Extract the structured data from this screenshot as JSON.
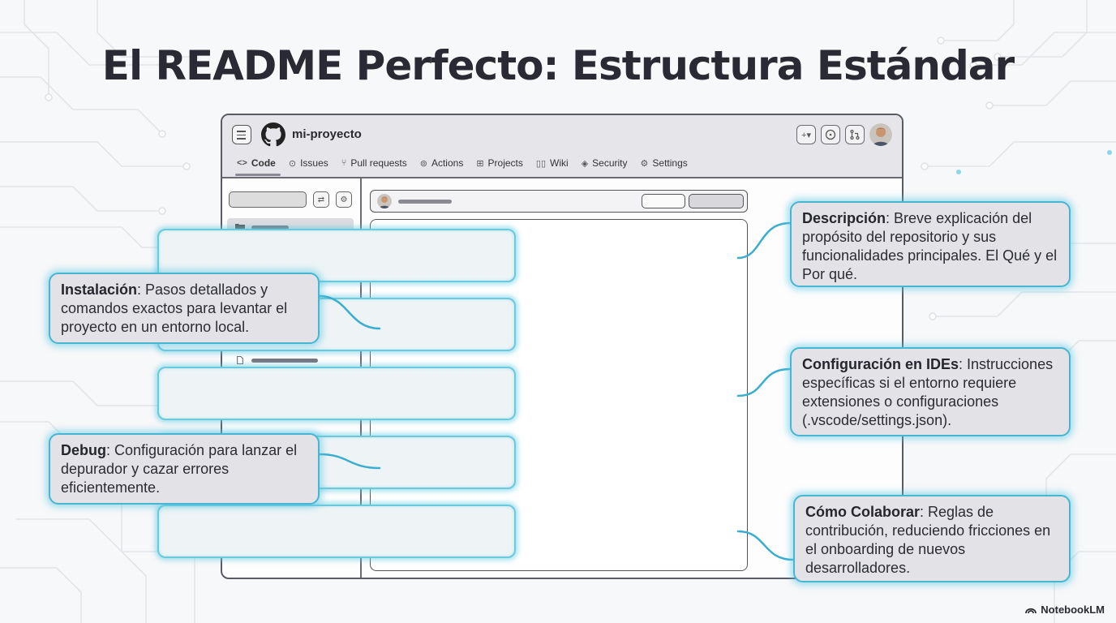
{
  "title": "El README Perfecto: Estructura Estándar",
  "window": {
    "repo_name": "mi-proyecto",
    "top_icons": [
      "plus-icon",
      "issue-icon",
      "pull-request-icon",
      "user-avatar"
    ],
    "tabs": [
      {
        "label": "Code",
        "icon": "code-icon"
      },
      {
        "label": "Issues",
        "icon": "issue-icon"
      },
      {
        "label": "Pull requests",
        "icon": "pull-request-icon"
      },
      {
        "label": "Actions",
        "icon": "actions-icon"
      },
      {
        "label": "Projects",
        "icon": "projects-icon"
      },
      {
        "label": "Wiki",
        "icon": "book-icon"
      },
      {
        "label": "Security",
        "icon": "shield-icon"
      },
      {
        "label": "Settings",
        "icon": "gear-icon"
      }
    ],
    "active_tab": "Code"
  },
  "callouts": {
    "descripcion": {
      "term": "Descripción",
      "text": ": Breve explicación del propósito del repositorio y sus funcionalidades principales. El Qué y el Por qué."
    },
    "instalacion": {
      "term": "Instalación",
      "text": ": Pasos detallados y comandos exactos para levantar el proyecto en un entorno local."
    },
    "configuracion": {
      "term": "Configuración en IDEs",
      "text": ": Instrucciones específicas si el entorno requiere extensiones o configuraciones (.vscode/settings.json)."
    },
    "debug": {
      "term": "Debug",
      "text": ": Configuración para lanzar el depurador y cazar errores eficientemente."
    },
    "colaborar": {
      "term": "Cómo Colaborar",
      "text": ": Reglas de contribución, reduciendo fricciones en el onboarding de nuevos desarrolladores."
    }
  },
  "brand": "NotebookLM",
  "colors": {
    "accent_glow": "#48b6d2",
    "section_fill": "#eef4f6",
    "callout_fill": "#e3e3e7",
    "title": "#2a2a35"
  }
}
